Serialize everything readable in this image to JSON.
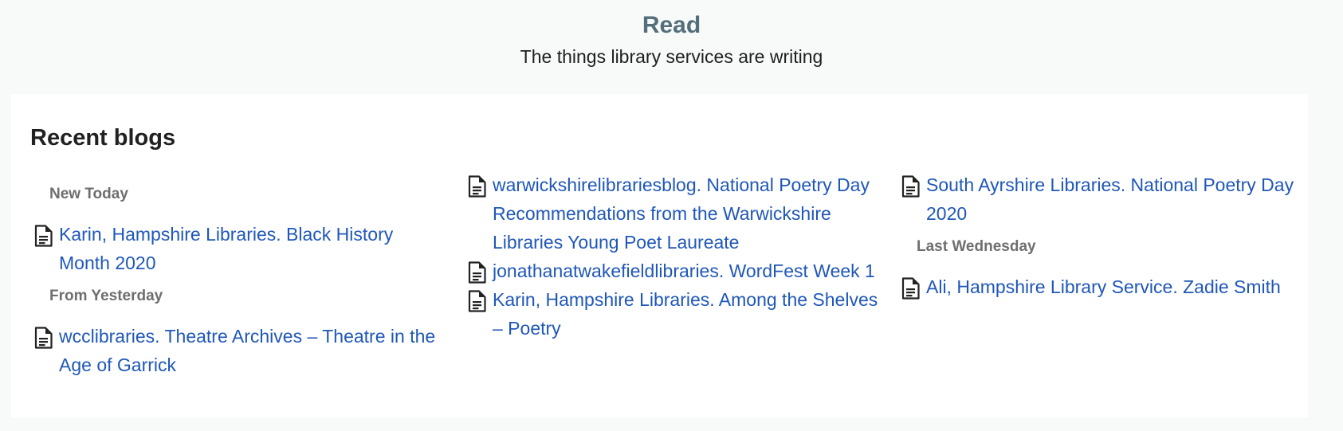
{
  "header": {
    "title": "Read",
    "subtitle": "The things library services are writing"
  },
  "recent_blogs": {
    "title": "Recent blogs",
    "columns": [
      {
        "groups": [
          {
            "heading": "New Today",
            "items": [
              {
                "icon": "document-icon",
                "text": "Karin, Hampshire Libraries. Black History Month 2020"
              }
            ]
          },
          {
            "heading": "From Yesterday",
            "items": [
              {
                "icon": "document-icon",
                "text": "wcclibraries. Theatre Archives – Theatre in the Age of Garrick"
              }
            ]
          }
        ]
      },
      {
        "groups": [
          {
            "heading": "",
            "items": [
              {
                "icon": "document-icon",
                "text": "warwickshirelibrariesblog. National Poetry Day Recommendations from the Warwickshire Libraries Young Poet Laureate"
              },
              {
                "icon": "document-icon",
                "text": "jonathanatwakefieldlibraries. WordFest Week 1"
              },
              {
                "icon": "document-icon",
                "text": "Karin, Hampshire Libraries. Among the Shelves – Poetry"
              }
            ]
          }
        ]
      },
      {
        "groups": [
          {
            "heading": "",
            "items": [
              {
                "icon": "document-icon",
                "text": "South Ayrshire Libraries. National Poetry Day 2020"
              }
            ]
          },
          {
            "heading": "Last Wednesday",
            "items": [
              {
                "icon": "document-icon",
                "text": "Ali, Hampshire Library Service. Zadie Smith"
              }
            ]
          }
        ]
      }
    ]
  },
  "colors": {
    "title": "#546e7a",
    "link": "#1f57b8",
    "group_heading": "#6e6e6e",
    "background": "#f8f9f9",
    "card": "#ffffff"
  }
}
